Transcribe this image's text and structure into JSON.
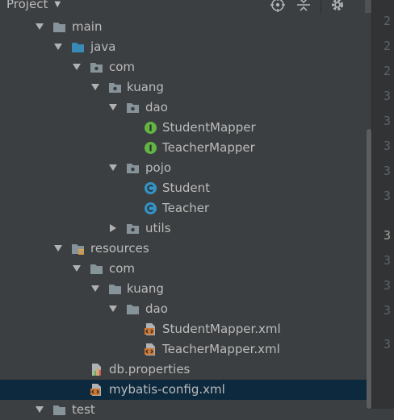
{
  "header": {
    "title": "Project",
    "icons": [
      "locate-icon",
      "collapse-all-icon",
      "gear-icon"
    ]
  },
  "tree": {
    "rows": [
      {
        "label": "main",
        "icon": "folder-icon",
        "expanded": true
      },
      {
        "label": "java",
        "icon": "source-folder-icon",
        "expanded": true
      },
      {
        "label": "com",
        "icon": "package-icon",
        "expanded": true
      },
      {
        "label": "kuang",
        "icon": "package-icon",
        "expanded": true
      },
      {
        "label": "dao",
        "icon": "package-icon",
        "expanded": true
      },
      {
        "label": "StudentMapper",
        "icon": "interface-icon"
      },
      {
        "label": "TeacherMapper",
        "icon": "interface-icon"
      },
      {
        "label": "pojo",
        "icon": "package-icon",
        "expanded": true
      },
      {
        "label": "Student",
        "icon": "class-icon"
      },
      {
        "label": "Teacher",
        "icon": "class-icon"
      },
      {
        "label": "utils",
        "icon": "package-icon",
        "expanded": false
      },
      {
        "label": "resources",
        "icon": "resources-folder-icon",
        "expanded": true
      },
      {
        "label": "com",
        "icon": "folder-icon",
        "expanded": true
      },
      {
        "label": "kuang",
        "icon": "folder-icon",
        "expanded": true
      },
      {
        "label": "dao",
        "icon": "folder-icon",
        "expanded": true
      },
      {
        "label": "StudentMapper.xml",
        "icon": "xml-file-icon"
      },
      {
        "label": "TeacherMapper.xml",
        "icon": "xml-file-icon"
      },
      {
        "label": "db.properties",
        "icon": "properties-file-icon"
      },
      {
        "label": "mybatis-config.xml",
        "icon": "xml-file-icon",
        "selected": true
      },
      {
        "label": "test",
        "icon": "folder-icon",
        "expanded": true
      }
    ]
  },
  "gutter": {
    "line_numbers": [
      "2",
      "2",
      "2",
      "3",
      "3",
      "3",
      "3",
      "3",
      "3",
      "3",
      "3",
      "3",
      "3",
      "3",
      "3",
      "3",
      "3"
    ],
    "current_index": 8
  }
}
